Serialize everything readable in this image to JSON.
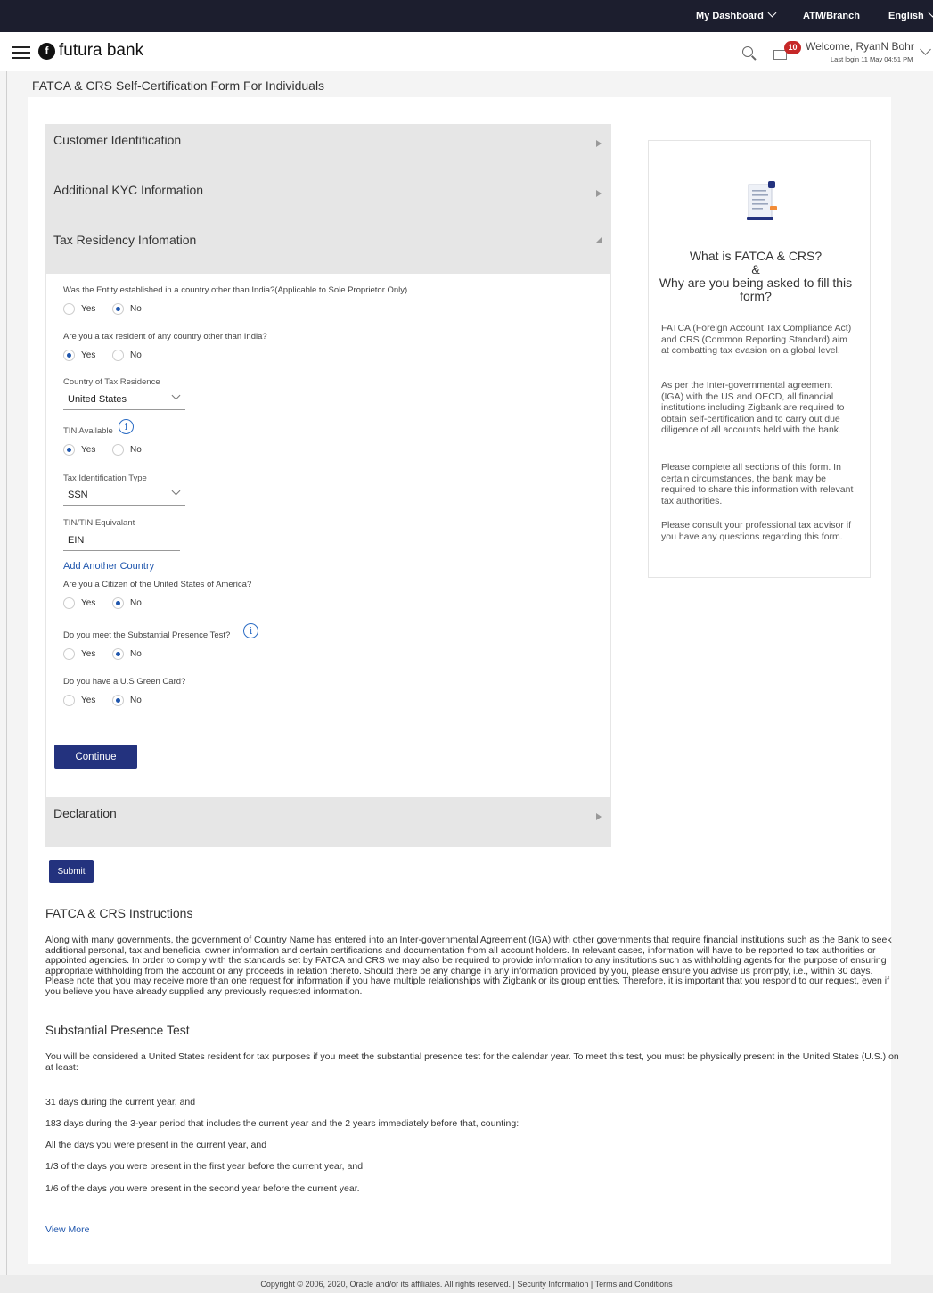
{
  "topbar": {
    "dashboard": "My Dashboard",
    "atm": "ATM/Branch",
    "language": "English"
  },
  "header": {
    "logo_text": "futura bank",
    "notification_count": "10",
    "welcome": "Welcome, RyanN Bohr",
    "last_login": "Last login 11 May 04:51 PM"
  },
  "page_title": "FATCA & CRS Self-Certification Form For Individuals",
  "sections": {
    "customer_identification": "Customer Identification",
    "additional_kyc": "Additional KYC Information",
    "tax_residency": "Tax Residency Infomation",
    "declaration": "Declaration"
  },
  "form": {
    "q_entity": "Was the Entity established in a country other than India?(Applicable to Sole Proprietor Only)",
    "q_tax_resident": "Are you a tax resident of any country other than India?",
    "country_label": "Country of Tax Residence",
    "country_value": "United States",
    "tin_available_label": "TIN Available",
    "tax_id_type_label": "Tax Identification Type",
    "tax_id_type_value": "SSN",
    "tin_label": "TIN/TIN Equivalant",
    "tin_value": "EIN",
    "add_country": "Add Another Country",
    "q_citizen": "Are you a Citizen of the United States of America?",
    "q_substantial": "Do you meet the Substantial Presence Test?",
    "q_green_card": "Do you have a U.S Green Card?",
    "yes": "Yes",
    "no": "No",
    "continue": "Continue",
    "submit": "Submit",
    "answers": {
      "entity": "No",
      "tax_resident": "Yes",
      "tin_available": "Yes",
      "citizen": "No",
      "substantial": "No",
      "green_card": "No"
    }
  },
  "side_card": {
    "title_1": "What is FATCA & CRS?",
    "title_2": "&",
    "title_3": "Why are you being asked to fill this form?",
    "p1": "FATCA (Foreign Account Tax Compliance Act) and CRS (Common Reporting Standard) aim at combatting tax evasion on a global level.",
    "p2": "As per the Inter-governmental agreement (IGA) with the US and OECD, all financial institutions including Zigbank are required to obtain self-certification and to carry out due diligence of all accounts held with the bank.",
    "p3": "Please complete all sections of this form. In certain circumstances, the bank may be required to share this information with relevant tax authorities.",
    "p4": "Please consult your professional tax advisor if you have any questions regarding this form."
  },
  "instructions": {
    "title": "FATCA & CRS Instructions",
    "text": "Along with many governments, the government of Country Name has entered into an Inter-governmental Agreement (IGA) with other governments that require financial institutions such as the Bank to seek additional personal, tax and beneficial owner information and certain certifications and documentation from all account holders. In relevant cases, information will have to be reported to tax authorities or appointed agencies. In order to comply with the standards set by FATCA and CRS we may also be required to provide information to any institutions such as withholding agents for the purpose of ensuring appropriate withholding from the account or any proceeds in relation thereto. Should there be any change in any information provided by you, please ensure you advise us promptly, i.e., within 30 days. Please note that you may receive more than one request for information if you have multiple relationships with Zigbank or its group entities. Therefore, it is important that you respond to our request, even if you believe you have already supplied any previously requested information."
  },
  "substantial_presence": {
    "title": "Substantial Presence Test",
    "intro": "You will be considered a United States resident for tax purposes if you meet the substantial presence test for the calendar year. To meet this test, you must be physically present in the United States (U.S.) on at least:",
    "lines": [
      "31 days during the current year, and",
      "183 days during the 3-year period that includes the current year and the 2 years immediately before that, counting:",
      "All the days you were present in the current year, and",
      "1/3 of the days you were present in the first year before the current year, and",
      "1/6 of the days you were present in the second year before the current year."
    ],
    "view_more": "View More"
  },
  "footer": {
    "copyright": "Copyright © 2006, 2020, Oracle and/or its affiliates. All rights reserved.",
    "sep": "|",
    "security": "Security Information",
    "terms": "Terms and Conditions"
  }
}
